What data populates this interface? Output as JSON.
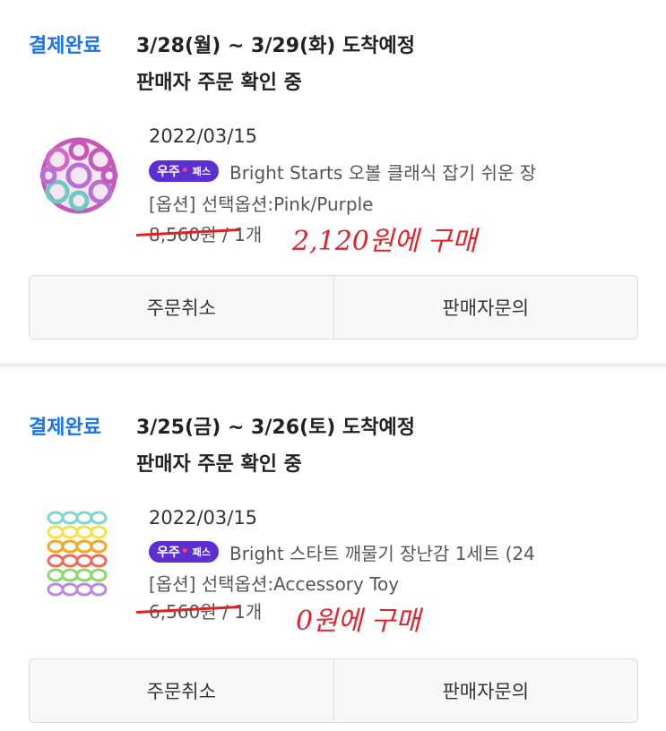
{
  "orders": [
    {
      "status": "결제완료",
      "delivery": "3/28(월) ~ 3/29(화) 도착예정",
      "seller_status": "판매자 주문 확인 중",
      "order_date": "2022/03/15",
      "badge": {
        "part1": "우주",
        "dot": "•",
        "part2": "패스"
      },
      "product_name": "Bright Starts 오볼 클래식 잡기 쉬운 장",
      "option": "[옵션] 선택옵션:Pink/Purple",
      "price": "8,560원",
      "quantity": "/ 1개",
      "annotation": "2,120원에 구매",
      "thumbnail_icon": "oball-pink-purple-icon",
      "cancel_label": "주문취소",
      "inquiry_label": "판매자문의"
    },
    {
      "status": "결제완료",
      "delivery": "3/25(금) ~ 3/26(토) 도착예정",
      "seller_status": "판매자 주문 확인 중",
      "order_date": "2022/03/15",
      "badge": {
        "part1": "우주",
        "dot": "•",
        "part2": "패스"
      },
      "product_name": "Bright 스타트 깨물기 장난감 1세트 (24",
      "option": "[옵션] 선택옵션:Accessory Toy",
      "price": "6,560원",
      "quantity": "/ 1개",
      "annotation": "0원에 구매",
      "thumbnail_icon": "rainbow-links-icon",
      "cancel_label": "주문취소",
      "inquiry_label": "판매자문의"
    }
  ],
  "colors": {
    "status": "#1a73e8",
    "badge": "#5b2fd1",
    "annotation": "#e0242e"
  }
}
